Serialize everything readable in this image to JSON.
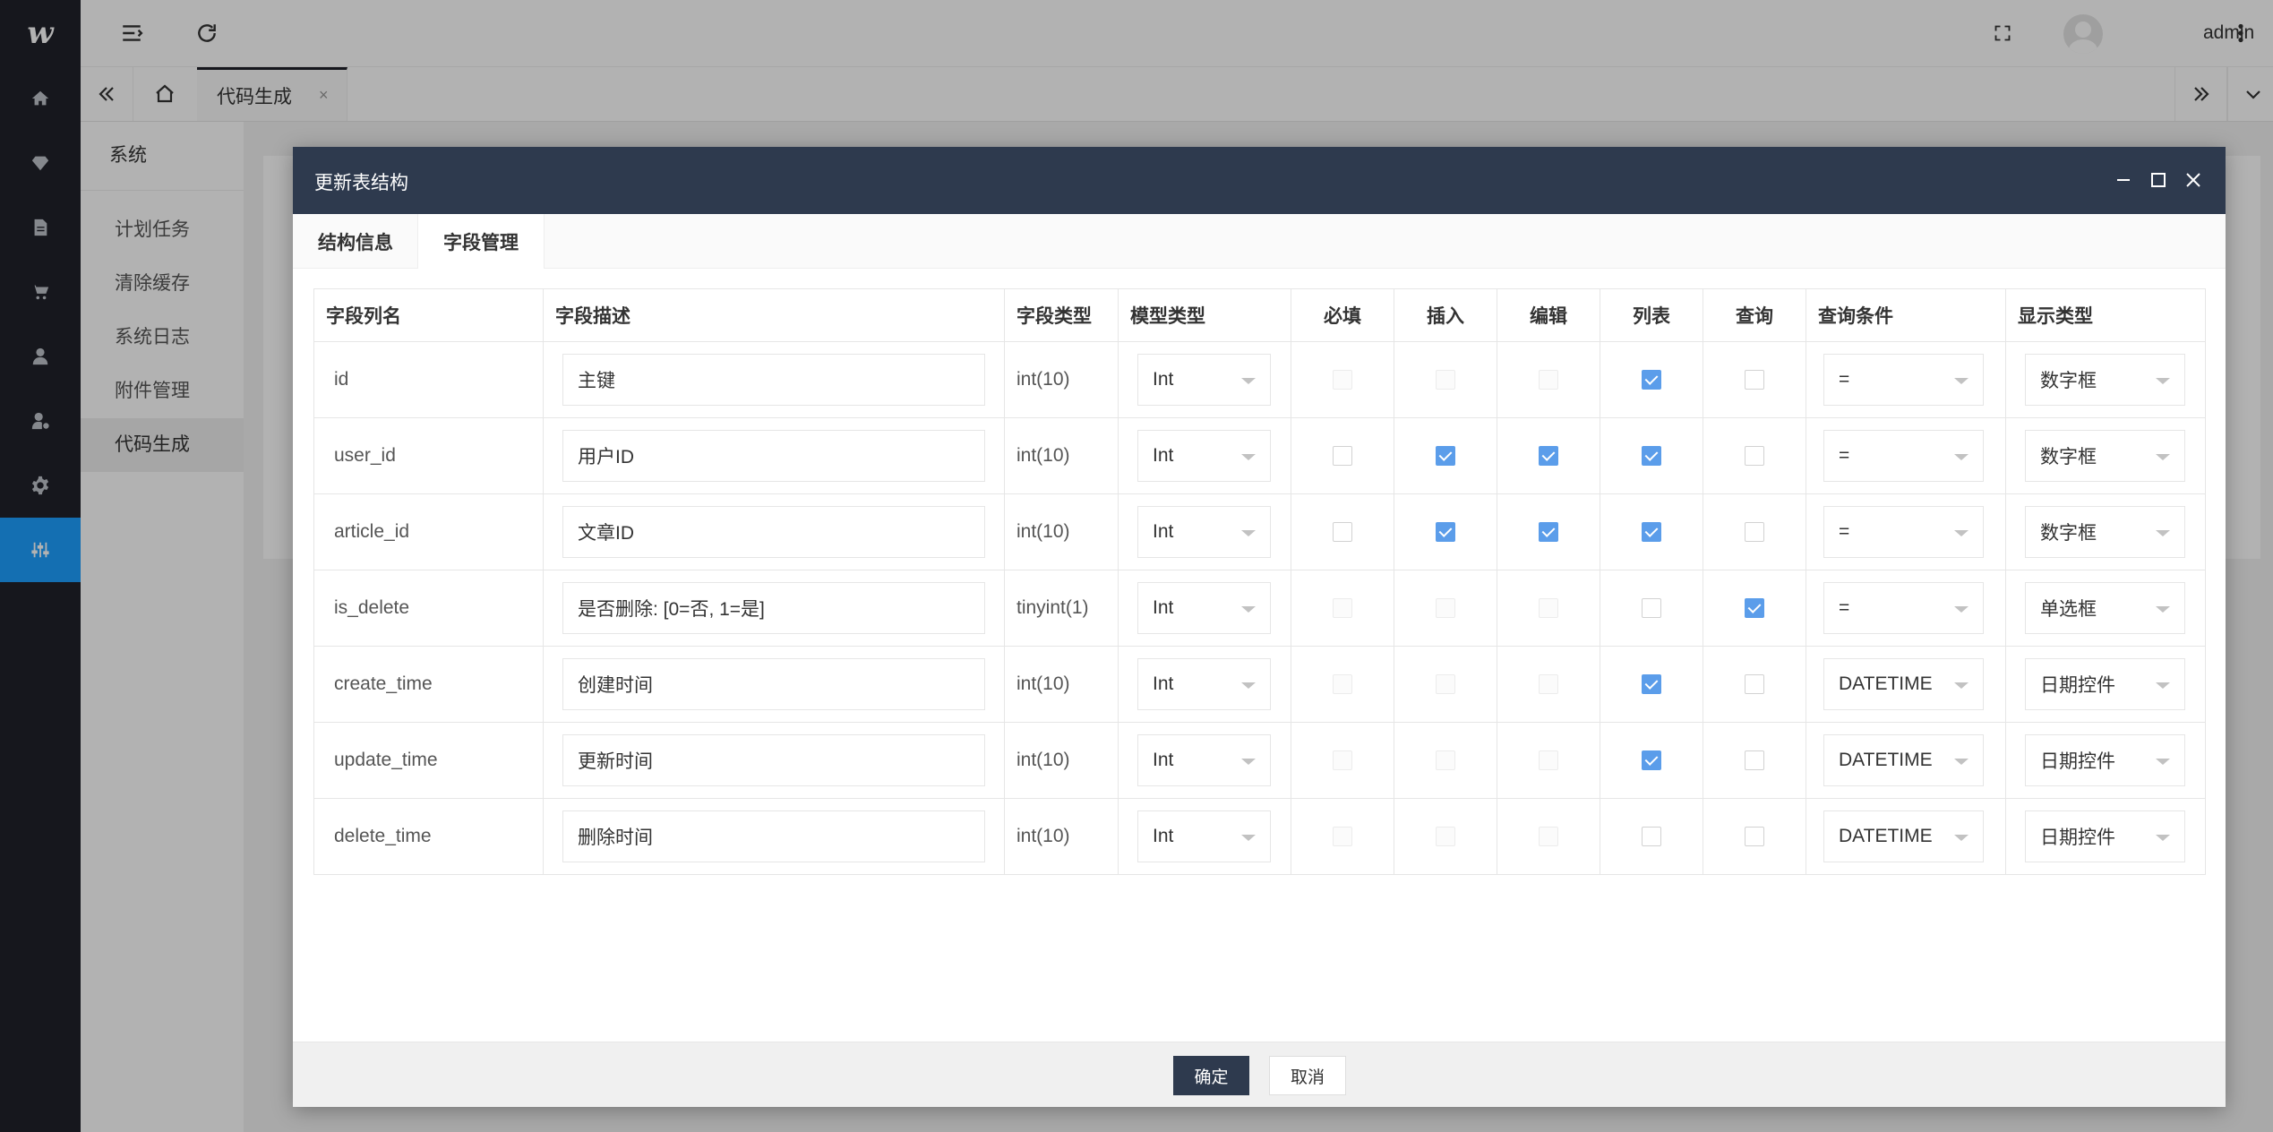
{
  "app": {
    "logo": "w",
    "username": "admin"
  },
  "rail": [
    {
      "icon": "home-icon"
    },
    {
      "icon": "diamond-icon"
    },
    {
      "icon": "document-icon"
    },
    {
      "icon": "cart-icon"
    },
    {
      "icon": "user-icon"
    },
    {
      "icon": "user-settings-icon"
    },
    {
      "icon": "gear-icon"
    },
    {
      "icon": "sliders-icon",
      "active": true
    }
  ],
  "tabs": {
    "active_label": "代码生成",
    "close": "×"
  },
  "submenu": {
    "title": "系统",
    "items": [
      "计划任务",
      "清除缓存",
      "系统日志",
      "附件管理",
      "代码生成"
    ],
    "active_index": 4
  },
  "modal": {
    "title": "更新表结构",
    "tabs": [
      "结构信息",
      "字段管理"
    ],
    "active_tab": 1,
    "columns": [
      "字段列名",
      "字段描述",
      "字段类型",
      "模型类型",
      "必填",
      "插入",
      "编辑",
      "列表",
      "查询",
      "查询条件",
      "显示类型"
    ],
    "rows": [
      {
        "name": "id",
        "desc": "主键",
        "type": "int(10)",
        "model": "Int",
        "required": "disabled",
        "insert": "disabled",
        "edit": "disabled",
        "list": "on",
        "query": "off",
        "cond": "=",
        "display": "数字框"
      },
      {
        "name": "user_id",
        "desc": "用户ID",
        "type": "int(10)",
        "model": "Int",
        "required": "off",
        "insert": "on",
        "edit": "on",
        "list": "on",
        "query": "off",
        "cond": "=",
        "display": "数字框"
      },
      {
        "name": "article_id",
        "desc": "文章ID",
        "type": "int(10)",
        "model": "Int",
        "required": "off",
        "insert": "on",
        "edit": "on",
        "list": "on",
        "query": "off",
        "cond": "=",
        "display": "数字框"
      },
      {
        "name": "is_delete",
        "desc": "是否删除: [0=否, 1=是]",
        "type": "tinyint(1)",
        "model": "Int",
        "required": "disabled",
        "insert": "disabled",
        "edit": "disabled",
        "list": "off",
        "query": "on",
        "cond": "=",
        "display": "单选框"
      },
      {
        "name": "create_time",
        "desc": "创建时间",
        "type": "int(10)",
        "model": "Int",
        "required": "disabled",
        "insert": "disabled",
        "edit": "disabled",
        "list": "on",
        "query": "off",
        "cond": "DATETIME",
        "display": "日期控件"
      },
      {
        "name": "update_time",
        "desc": "更新时间",
        "type": "int(10)",
        "model": "Int",
        "required": "disabled",
        "insert": "disabled",
        "edit": "disabled",
        "list": "on",
        "query": "off",
        "cond": "DATETIME",
        "display": "日期控件"
      },
      {
        "name": "delete_time",
        "desc": "删除时间",
        "type": "int(10)",
        "model": "Int",
        "required": "disabled",
        "insert": "disabled",
        "edit": "disabled",
        "list": "off",
        "query": "off",
        "cond": "DATETIME",
        "display": "日期控件"
      }
    ],
    "buttons": {
      "confirm": "确定",
      "cancel": "取消"
    }
  },
  "colors": {
    "rail_bg": "#20222a",
    "rail_active": "#1e9fff",
    "modal_header": "#2e3a4e",
    "checkbox_on": "#5b9dea"
  }
}
